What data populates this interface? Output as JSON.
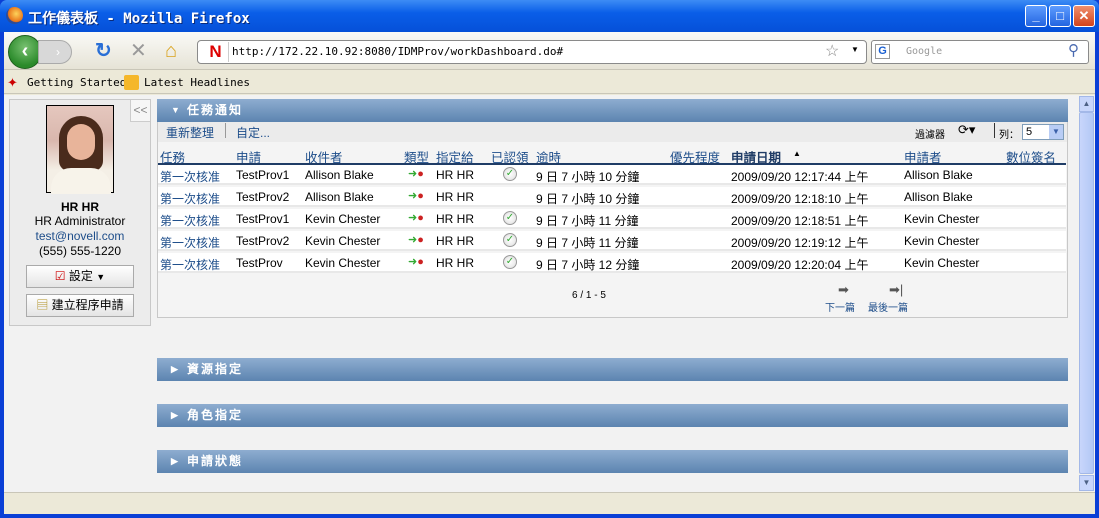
{
  "window": {
    "title": "工作儀表板 - Mozilla Firefox",
    "minimize": "_",
    "maximize": "□",
    "close": "✕"
  },
  "browser": {
    "url": "http://172.22.10.92:8080/IDMProv/workDashboard.do#",
    "search_placeholder": "Google",
    "bookmarks": [
      "Getting Started",
      "Latest Headlines"
    ]
  },
  "profile": {
    "name": "HR HR",
    "title": "HR Administrator",
    "email": "test@novell.com",
    "phone": "(555) 555-1220",
    "settings_label": "設定",
    "create_request_label": "建立程序申請",
    "collapse": "<<"
  },
  "task_panel": {
    "title": "任務通知",
    "refresh": "重新整理",
    "customize": "自定...",
    "filter": "過濾器",
    "rows_label": "列：",
    "rows_value": "5",
    "columns": [
      "任務",
      "申請",
      "收件者",
      "類型",
      "指定給",
      "已認領",
      "逾時",
      "優先程度",
      "申請日期",
      "申請者",
      "數位簽名"
    ],
    "sort_indicator": "▲",
    "rows": [
      {
        "task": "第一次核准",
        "request": "TestProv1",
        "recipient": "Allison Blake",
        "assigned": "HR HR",
        "claimed": true,
        "timeout": "9 日 7 小時 10 分鐘",
        "priority": "",
        "date": "2009/09/20 12:17:44 上午",
        "requester": "Allison Blake",
        "signature": ""
      },
      {
        "task": "第一次核准",
        "request": "TestProv2",
        "recipient": "Allison Blake",
        "assigned": "HR HR",
        "claimed": false,
        "timeout": "9 日 7 小時 10 分鐘",
        "priority": "",
        "date": "2009/09/20 12:18:10 上午",
        "requester": "Allison Blake",
        "signature": ""
      },
      {
        "task": "第一次核准",
        "request": "TestProv1",
        "recipient": "Kevin Chester",
        "assigned": "HR HR",
        "claimed": true,
        "timeout": "9 日 7 小時 11 分鐘",
        "priority": "",
        "date": "2009/09/20 12:18:51 上午",
        "requester": "Kevin Chester",
        "signature": ""
      },
      {
        "task": "第一次核准",
        "request": "TestProv2",
        "recipient": "Kevin Chester",
        "assigned": "HR HR",
        "claimed": true,
        "timeout": "9 日 7 小時 11 分鐘",
        "priority": "",
        "date": "2009/09/20 12:19:12 上午",
        "requester": "Kevin Chester",
        "signature": ""
      },
      {
        "task": "第一次核准",
        "request": "TestProv",
        "recipient": "Kevin Chester",
        "assigned": "HR HR",
        "claimed": true,
        "timeout": "9 日 7 小時 12 分鐘",
        "priority": "",
        "date": "2009/09/20 12:20:04 上午",
        "requester": "Kevin Chester",
        "signature": ""
      }
    ],
    "page_info": "6 / 1 - 5",
    "next": "下一篇",
    "last": "最後一篇"
  },
  "sections": [
    "資源指定",
    "角色指定",
    "申請狀態"
  ]
}
